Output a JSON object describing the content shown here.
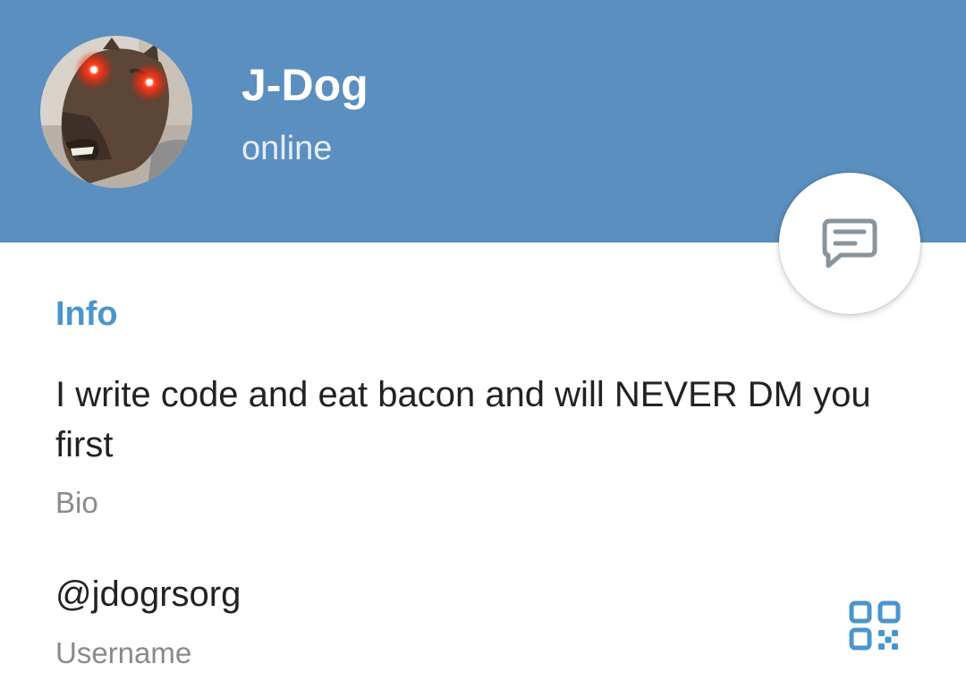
{
  "colors": {
    "header_bg": "#5a8fbf",
    "accent": "#4a95cc",
    "fab_icon": "#8a949c"
  },
  "profile": {
    "name": "J-Dog",
    "status": "online"
  },
  "fab": {
    "icon": "message-icon"
  },
  "info": {
    "section_title": "Info",
    "bio": "I write code and eat bacon and will NEVER DM you first",
    "bio_label": "Bio",
    "username": "@jdogrsorg",
    "username_label": "Username",
    "qr_icon": "qr-code-icon"
  }
}
